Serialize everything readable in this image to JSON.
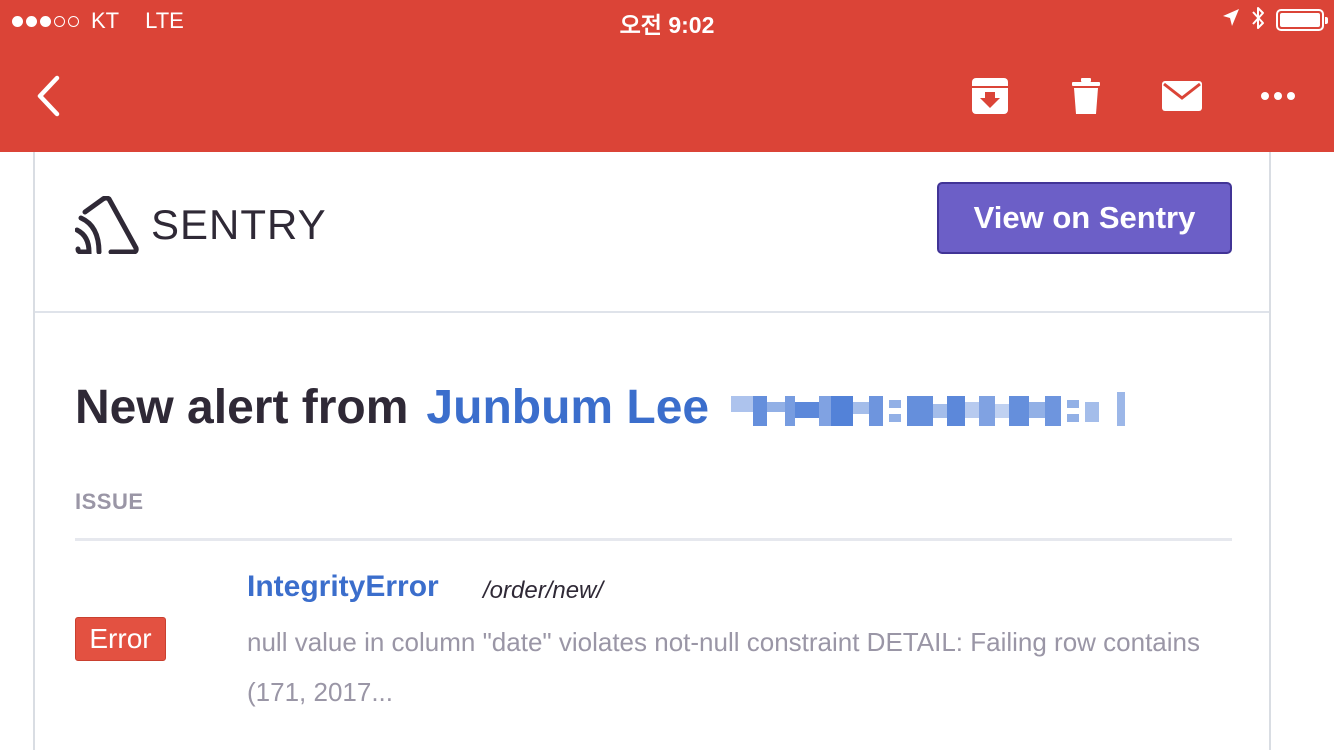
{
  "status_bar": {
    "signal_strength": 3,
    "signal_max": 5,
    "carrier": "KT",
    "network": "LTE",
    "time": "오전 9:02",
    "battery_level": 1.0
  },
  "toolbar": {
    "back_icon": "chevron-left-icon",
    "actions": [
      "archive-icon",
      "trash-icon",
      "mail-icon",
      "more-icon"
    ],
    "background_color": "#db4437"
  },
  "email": {
    "brand": "SENTRY",
    "view_button_label": "View on Sentry",
    "view_button_color": "#6c5fc7",
    "heading_prefix": "New alert from",
    "heading_author": "Junbum Lee",
    "section_label": "ISSUE",
    "issue": {
      "level": "Error",
      "title": "IntegrityError",
      "culprit": "/order/new/",
      "message": "null value in column \"date\" violates not-null constraint DETAIL: Failing row contains (171, 2017..."
    },
    "accent_color": "#3b6ecc",
    "error_color": "#e35141"
  }
}
